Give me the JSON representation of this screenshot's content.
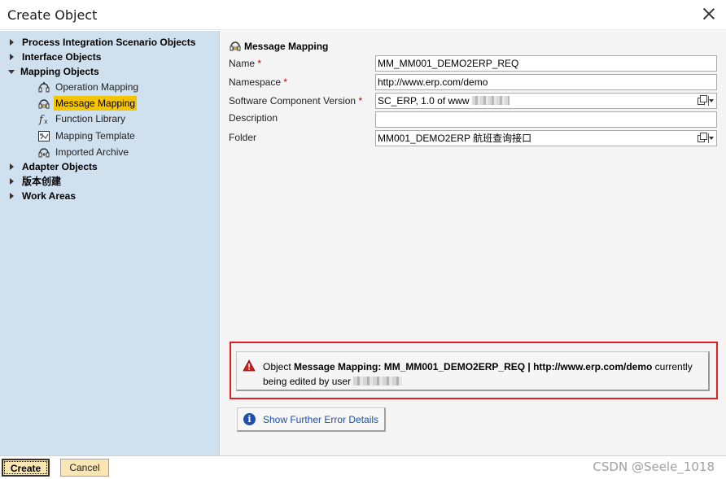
{
  "window": {
    "title": "Create Object"
  },
  "tree": {
    "nodes": [
      {
        "label": "Process Integration Scenario Objects",
        "expanded": false
      },
      {
        "label": "Interface Objects",
        "expanded": false
      },
      {
        "label": "Mapping Objects",
        "expanded": true,
        "children": [
          {
            "label": "Operation Mapping",
            "icon": "operation-mapping-icon"
          },
          {
            "label": "Message Mapping",
            "icon": "message-mapping-icon",
            "selected": true
          },
          {
            "label": "Function Library",
            "icon": "function-library-icon"
          },
          {
            "label": "Mapping Template",
            "icon": "mapping-template-icon"
          },
          {
            "label": "Imported Archive",
            "icon": "imported-archive-icon"
          }
        ]
      },
      {
        "label": "Adapter Objects",
        "expanded": false
      },
      {
        "label": "版本创建",
        "expanded": false
      },
      {
        "label": "Work Areas",
        "expanded": false
      }
    ]
  },
  "form": {
    "header": "Message Mapping",
    "fields": {
      "name": {
        "label": "Name",
        "required": "*",
        "value": "MM_MM001_DEMO2ERP_REQ"
      },
      "namespace": {
        "label": "Namespace",
        "required": "*",
        "value": "http://www.erp.com/demo"
      },
      "swcv": {
        "label": "Software Component Version",
        "required": "*",
        "value": "SC_ERP, 1.0 of www"
      },
      "description": {
        "label": "Description",
        "value": ""
      },
      "folder": {
        "label": "Folder",
        "value": "MM001_DEMO2ERP 航班查询接口"
      }
    }
  },
  "error": {
    "prefix": "Object ",
    "object": "Message Mapping: MM_MM001_DEMO2ERP_REQ | http://www.erp.com/demo",
    "suffix": " currently being edited by user "
  },
  "details_button": {
    "label": "Show Further Error Details"
  },
  "footer": {
    "create_label": "Create",
    "cancel_label": "Cancel",
    "watermark": "CSDN @Seele_1018"
  },
  "colors": {
    "tree_bg": "#cfe0ef",
    "selected": "#f5c400",
    "button_bg": "#fae5b4",
    "error_border": "#e02020",
    "link_blue": "#1f4fa8"
  }
}
